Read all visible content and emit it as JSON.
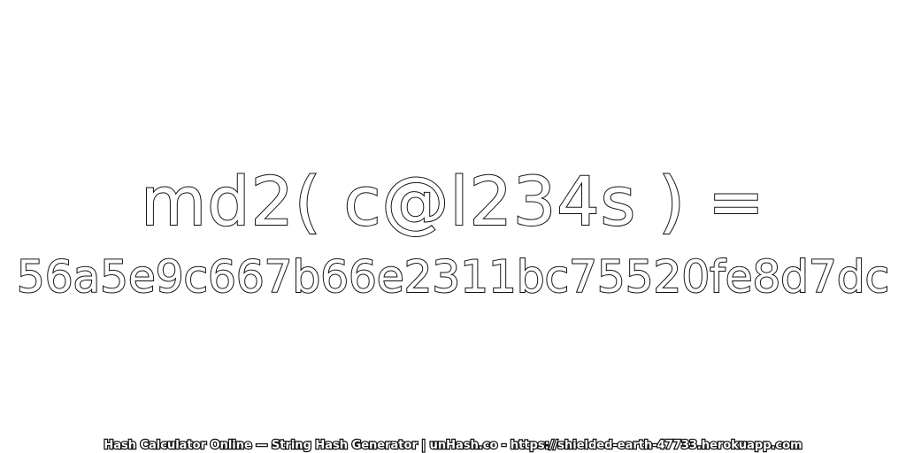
{
  "expression": "md2( c@l234s ) =",
  "hash_value": "56a5e9c667b66e2311bc75520fe8d7dc",
  "footer": "Hash Calculator Online — String Hash Generator | unHash.co - https://shielded-earth-47733.herokuapp.com",
  "colors": {
    "background": "#ffffff",
    "text_fill": "#ffffff",
    "text_outline": "#111111"
  }
}
